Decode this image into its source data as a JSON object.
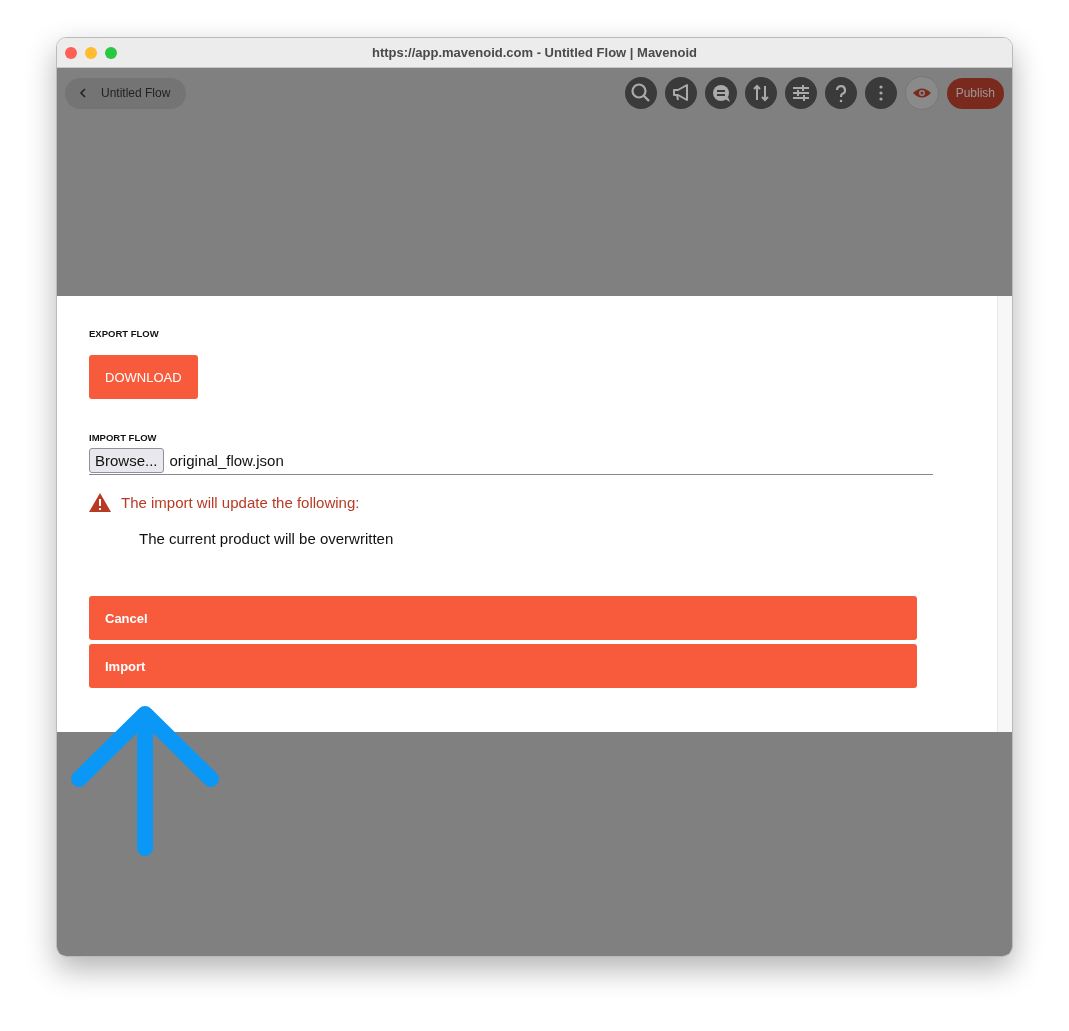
{
  "window": {
    "title": "https://app.mavenoid.com - Untitled Flow | Mavenoid"
  },
  "top_bar": {
    "back_label": "Untitled Flow",
    "publish_label": "Publish"
  },
  "modal": {
    "export_heading": "EXPORT FLOW",
    "download_label": "DOWNLOAD",
    "import_heading": "IMPORT FLOW",
    "browse_label": "Browse...",
    "file_name": "original_flow.json",
    "warning": "The import will update the following:",
    "changes": [
      "The current product will be overwritten"
    ],
    "actions": [
      {
        "label": "Cancel"
      },
      {
        "label": "Import"
      }
    ]
  }
}
